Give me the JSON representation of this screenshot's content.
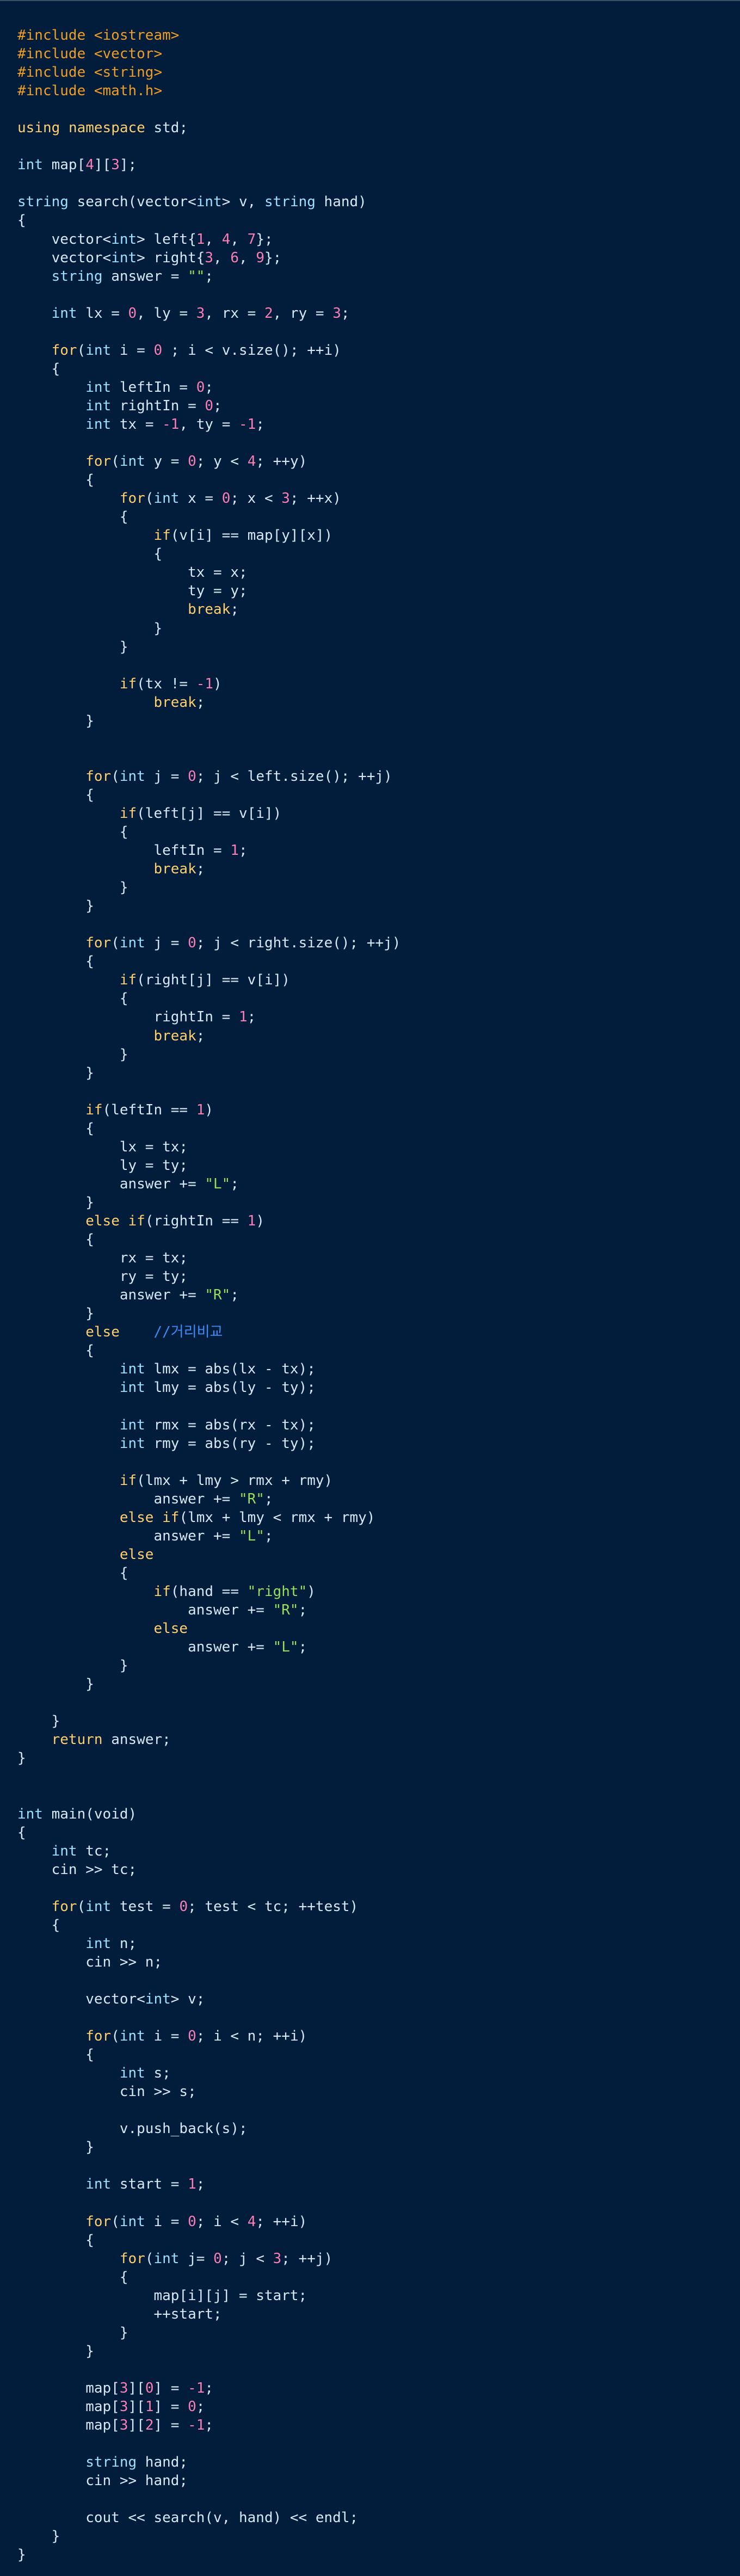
{
  "colors": {
    "background": "#011d3b",
    "plain": "#d7e8f6",
    "keyword": "#ffcf6e",
    "preprocessor": "#ef9d25",
    "type": "#9ee0ff",
    "number": "#f97fb4",
    "string": "#97df5c",
    "comment": "#3d8df5"
  },
  "code_lines": [
    [
      [
        "pp",
        "#include <iostream>"
      ]
    ],
    [
      [
        "pp",
        "#include <vector>"
      ]
    ],
    [
      [
        "pp",
        "#include <string>"
      ]
    ],
    [
      [
        "pp",
        "#include <math.h>"
      ]
    ],
    [],
    [
      [
        "k",
        "using"
      ],
      [
        "p",
        " "
      ],
      [
        "k",
        "namespace"
      ],
      [
        "p",
        " std;"
      ]
    ],
    [],
    [
      [
        "t",
        "int"
      ],
      [
        "p",
        " map["
      ],
      [
        "n",
        "4"
      ],
      [
        "p",
        "]["
      ],
      [
        "n",
        "3"
      ],
      [
        "p",
        "];"
      ]
    ],
    [],
    [
      [
        "t",
        "string"
      ],
      [
        "p",
        " search(vector<"
      ],
      [
        "t",
        "int"
      ],
      [
        "p",
        "> v, "
      ],
      [
        "t",
        "string"
      ],
      [
        "p",
        " hand)"
      ]
    ],
    [
      [
        "p",
        "{"
      ]
    ],
    [
      [
        "p",
        "    vector<"
      ],
      [
        "t",
        "int"
      ],
      [
        "p",
        "> left{"
      ],
      [
        "n",
        "1"
      ],
      [
        "p",
        ", "
      ],
      [
        "n",
        "4"
      ],
      [
        "p",
        ", "
      ],
      [
        "n",
        "7"
      ],
      [
        "p",
        "};"
      ]
    ],
    [
      [
        "p",
        "    vector<"
      ],
      [
        "t",
        "int"
      ],
      [
        "p",
        "> right{"
      ],
      [
        "n",
        "3"
      ],
      [
        "p",
        ", "
      ],
      [
        "n",
        "6"
      ],
      [
        "p",
        ", "
      ],
      [
        "n",
        "9"
      ],
      [
        "p",
        "};"
      ]
    ],
    [
      [
        "p",
        "    "
      ],
      [
        "t",
        "string"
      ],
      [
        "p",
        " answer = "
      ],
      [
        "s",
        "\"\""
      ],
      [
        "p",
        ";"
      ]
    ],
    [],
    [
      [
        "p",
        "    "
      ],
      [
        "t",
        "int"
      ],
      [
        "p",
        " lx = "
      ],
      [
        "n",
        "0"
      ],
      [
        "p",
        ", ly = "
      ],
      [
        "n",
        "3"
      ],
      [
        "p",
        ", rx = "
      ],
      [
        "n",
        "2"
      ],
      [
        "p",
        ", ry = "
      ],
      [
        "n",
        "3"
      ],
      [
        "p",
        ";"
      ]
    ],
    [],
    [
      [
        "p",
        "    "
      ],
      [
        "k",
        "for"
      ],
      [
        "p",
        "("
      ],
      [
        "t",
        "int"
      ],
      [
        "p",
        " i = "
      ],
      [
        "n",
        "0"
      ],
      [
        "p",
        " ; i < v.size(); ++i)"
      ]
    ],
    [
      [
        "p",
        "    {"
      ]
    ],
    [
      [
        "p",
        "        "
      ],
      [
        "t",
        "int"
      ],
      [
        "p",
        " leftIn = "
      ],
      [
        "n",
        "0"
      ],
      [
        "p",
        ";"
      ]
    ],
    [
      [
        "p",
        "        "
      ],
      [
        "t",
        "int"
      ],
      [
        "p",
        " rightIn = "
      ],
      [
        "n",
        "0"
      ],
      [
        "p",
        ";"
      ]
    ],
    [
      [
        "p",
        "        "
      ],
      [
        "t",
        "int"
      ],
      [
        "p",
        " tx = "
      ],
      [
        "n",
        "-1"
      ],
      [
        "p",
        ", ty = "
      ],
      [
        "n",
        "-1"
      ],
      [
        "p",
        ";"
      ]
    ],
    [],
    [
      [
        "p",
        "        "
      ],
      [
        "k",
        "for"
      ],
      [
        "p",
        "("
      ],
      [
        "t",
        "int"
      ],
      [
        "p",
        " y = "
      ],
      [
        "n",
        "0"
      ],
      [
        "p",
        "; y < "
      ],
      [
        "n",
        "4"
      ],
      [
        "p",
        "; ++y)"
      ]
    ],
    [
      [
        "p",
        "        {"
      ]
    ],
    [
      [
        "p",
        "            "
      ],
      [
        "k",
        "for"
      ],
      [
        "p",
        "("
      ],
      [
        "t",
        "int"
      ],
      [
        "p",
        " x = "
      ],
      [
        "n",
        "0"
      ],
      [
        "p",
        "; x < "
      ],
      [
        "n",
        "3"
      ],
      [
        "p",
        "; ++x)"
      ]
    ],
    [
      [
        "p",
        "            {"
      ]
    ],
    [
      [
        "p",
        "                "
      ],
      [
        "k",
        "if"
      ],
      [
        "p",
        "(v[i] == map[y][x])"
      ]
    ],
    [
      [
        "p",
        "                {"
      ]
    ],
    [
      [
        "p",
        "                    tx = x;"
      ]
    ],
    [
      [
        "p",
        "                    ty = y;"
      ]
    ],
    [
      [
        "p",
        "                    "
      ],
      [
        "k",
        "break"
      ],
      [
        "p",
        ";"
      ]
    ],
    [
      [
        "p",
        "                }"
      ]
    ],
    [
      [
        "p",
        "            }"
      ]
    ],
    [],
    [
      [
        "p",
        "            "
      ],
      [
        "k",
        "if"
      ],
      [
        "p",
        "(tx != "
      ],
      [
        "n",
        "-1"
      ],
      [
        "p",
        ")"
      ]
    ],
    [
      [
        "p",
        "                "
      ],
      [
        "k",
        "break"
      ],
      [
        "p",
        ";"
      ]
    ],
    [
      [
        "p",
        "        }"
      ]
    ],
    [],
    [],
    [
      [
        "p",
        "        "
      ],
      [
        "k",
        "for"
      ],
      [
        "p",
        "("
      ],
      [
        "t",
        "int"
      ],
      [
        "p",
        " j = "
      ],
      [
        "n",
        "0"
      ],
      [
        "p",
        "; j < left.size(); ++j)"
      ]
    ],
    [
      [
        "p",
        "        {"
      ]
    ],
    [
      [
        "p",
        "            "
      ],
      [
        "k",
        "if"
      ],
      [
        "p",
        "(left[j] == v[i])"
      ]
    ],
    [
      [
        "p",
        "            {"
      ]
    ],
    [
      [
        "p",
        "                leftIn = "
      ],
      [
        "n",
        "1"
      ],
      [
        "p",
        ";"
      ]
    ],
    [
      [
        "p",
        "                "
      ],
      [
        "k",
        "break"
      ],
      [
        "p",
        ";"
      ]
    ],
    [
      [
        "p",
        "            }"
      ]
    ],
    [
      [
        "p",
        "        }"
      ]
    ],
    [],
    [
      [
        "p",
        "        "
      ],
      [
        "k",
        "for"
      ],
      [
        "p",
        "("
      ],
      [
        "t",
        "int"
      ],
      [
        "p",
        " j = "
      ],
      [
        "n",
        "0"
      ],
      [
        "p",
        "; j < right.size(); ++j)"
      ]
    ],
    [
      [
        "p",
        "        {"
      ]
    ],
    [
      [
        "p",
        "            "
      ],
      [
        "k",
        "if"
      ],
      [
        "p",
        "(right[j] == v[i])"
      ]
    ],
    [
      [
        "p",
        "            {"
      ]
    ],
    [
      [
        "p",
        "                rightIn = "
      ],
      [
        "n",
        "1"
      ],
      [
        "p",
        ";"
      ]
    ],
    [
      [
        "p",
        "                "
      ],
      [
        "k",
        "break"
      ],
      [
        "p",
        ";"
      ]
    ],
    [
      [
        "p",
        "            }"
      ]
    ],
    [
      [
        "p",
        "        }"
      ]
    ],
    [],
    [
      [
        "p",
        "        "
      ],
      [
        "k",
        "if"
      ],
      [
        "p",
        "(leftIn == "
      ],
      [
        "n",
        "1"
      ],
      [
        "p",
        ")"
      ]
    ],
    [
      [
        "p",
        "        {"
      ]
    ],
    [
      [
        "p",
        "            lx = tx;"
      ]
    ],
    [
      [
        "p",
        "            ly = ty;"
      ]
    ],
    [
      [
        "p",
        "            answer += "
      ],
      [
        "s",
        "\"L\""
      ],
      [
        "p",
        ";"
      ]
    ],
    [
      [
        "p",
        "        }"
      ]
    ],
    [
      [
        "p",
        "        "
      ],
      [
        "k",
        "else"
      ],
      [
        "p",
        " "
      ],
      [
        "k",
        "if"
      ],
      [
        "p",
        "(rightIn == "
      ],
      [
        "n",
        "1"
      ],
      [
        "p",
        ")"
      ]
    ],
    [
      [
        "p",
        "        {"
      ]
    ],
    [
      [
        "p",
        "            rx = tx;"
      ]
    ],
    [
      [
        "p",
        "            ry = ty;"
      ]
    ],
    [
      [
        "p",
        "            answer += "
      ],
      [
        "s",
        "\"R\""
      ],
      [
        "p",
        ";"
      ]
    ],
    [
      [
        "p",
        "        }"
      ]
    ],
    [
      [
        "p",
        "        "
      ],
      [
        "k",
        "else"
      ],
      [
        "p",
        "    "
      ],
      [
        "c",
        "//거리비교"
      ]
    ],
    [
      [
        "p",
        "        {"
      ]
    ],
    [
      [
        "p",
        "            "
      ],
      [
        "t",
        "int"
      ],
      [
        "p",
        " lmx = abs(lx - tx);"
      ]
    ],
    [
      [
        "p",
        "            "
      ],
      [
        "t",
        "int"
      ],
      [
        "p",
        " lmy = abs(ly - ty);"
      ]
    ],
    [],
    [
      [
        "p",
        "            "
      ],
      [
        "t",
        "int"
      ],
      [
        "p",
        " rmx = abs(rx - tx);"
      ]
    ],
    [
      [
        "p",
        "            "
      ],
      [
        "t",
        "int"
      ],
      [
        "p",
        " rmy = abs(ry - ty);"
      ]
    ],
    [],
    [
      [
        "p",
        "            "
      ],
      [
        "k",
        "if"
      ],
      [
        "p",
        "(lmx + lmy > rmx + rmy)"
      ]
    ],
    [
      [
        "p",
        "                answer += "
      ],
      [
        "s",
        "\"R\""
      ],
      [
        "p",
        ";"
      ]
    ],
    [
      [
        "p",
        "            "
      ],
      [
        "k",
        "else"
      ],
      [
        "p",
        " "
      ],
      [
        "k",
        "if"
      ],
      [
        "p",
        "(lmx + lmy < rmx + rmy)"
      ]
    ],
    [
      [
        "p",
        "                answer += "
      ],
      [
        "s",
        "\"L\""
      ],
      [
        "p",
        ";"
      ]
    ],
    [
      [
        "p",
        "            "
      ],
      [
        "k",
        "else"
      ]
    ],
    [
      [
        "p",
        "            {"
      ]
    ],
    [
      [
        "p",
        "                "
      ],
      [
        "k",
        "if"
      ],
      [
        "p",
        "(hand == "
      ],
      [
        "s",
        "\"right\""
      ],
      [
        "p",
        ")"
      ]
    ],
    [
      [
        "p",
        "                    answer += "
      ],
      [
        "s",
        "\"R\""
      ],
      [
        "p",
        ";"
      ]
    ],
    [
      [
        "p",
        "                "
      ],
      [
        "k",
        "else"
      ]
    ],
    [
      [
        "p",
        "                    answer += "
      ],
      [
        "s",
        "\"L\""
      ],
      [
        "p",
        ";"
      ]
    ],
    [
      [
        "p",
        "            }"
      ]
    ],
    [
      [
        "p",
        "        }"
      ]
    ],
    [],
    [
      [
        "p",
        "    }"
      ]
    ],
    [
      [
        "p",
        "    "
      ],
      [
        "k",
        "return"
      ],
      [
        "p",
        " answer;"
      ]
    ],
    [
      [
        "p",
        "}"
      ]
    ],
    [],
    [],
    [
      [
        "t",
        "int"
      ],
      [
        "p",
        " main(void)"
      ]
    ],
    [
      [
        "p",
        "{"
      ]
    ],
    [
      [
        "p",
        "    "
      ],
      [
        "t",
        "int"
      ],
      [
        "p",
        " tc;"
      ]
    ],
    [
      [
        "p",
        "    cin >> tc;"
      ]
    ],
    [],
    [
      [
        "p",
        "    "
      ],
      [
        "k",
        "for"
      ],
      [
        "p",
        "("
      ],
      [
        "t",
        "int"
      ],
      [
        "p",
        " test = "
      ],
      [
        "n",
        "0"
      ],
      [
        "p",
        "; test < tc; ++test)"
      ]
    ],
    [
      [
        "p",
        "    {"
      ]
    ],
    [
      [
        "p",
        "        "
      ],
      [
        "t",
        "int"
      ],
      [
        "p",
        " n;"
      ]
    ],
    [
      [
        "p",
        "        cin >> n;"
      ]
    ],
    [],
    [
      [
        "p",
        "        vector<"
      ],
      [
        "t",
        "int"
      ],
      [
        "p",
        "> v;"
      ]
    ],
    [],
    [
      [
        "p",
        "        "
      ],
      [
        "k",
        "for"
      ],
      [
        "p",
        "("
      ],
      [
        "t",
        "int"
      ],
      [
        "p",
        " i = "
      ],
      [
        "n",
        "0"
      ],
      [
        "p",
        "; i < n; ++i)"
      ]
    ],
    [
      [
        "p",
        "        {"
      ]
    ],
    [
      [
        "p",
        "            "
      ],
      [
        "t",
        "int"
      ],
      [
        "p",
        " s;"
      ]
    ],
    [
      [
        "p",
        "            cin >> s;"
      ]
    ],
    [],
    [
      [
        "p",
        "            v.push_back(s);"
      ]
    ],
    [
      [
        "p",
        "        }"
      ]
    ],
    [],
    [
      [
        "p",
        "        "
      ],
      [
        "t",
        "int"
      ],
      [
        "p",
        " start = "
      ],
      [
        "n",
        "1"
      ],
      [
        "p",
        ";"
      ]
    ],
    [],
    [
      [
        "p",
        "        "
      ],
      [
        "k",
        "for"
      ],
      [
        "p",
        "("
      ],
      [
        "t",
        "int"
      ],
      [
        "p",
        " i = "
      ],
      [
        "n",
        "0"
      ],
      [
        "p",
        "; i < "
      ],
      [
        "n",
        "4"
      ],
      [
        "p",
        "; ++i)"
      ]
    ],
    [
      [
        "p",
        "        {"
      ]
    ],
    [
      [
        "p",
        "            "
      ],
      [
        "k",
        "for"
      ],
      [
        "p",
        "("
      ],
      [
        "t",
        "int"
      ],
      [
        "p",
        " j= "
      ],
      [
        "n",
        "0"
      ],
      [
        "p",
        "; j < "
      ],
      [
        "n",
        "3"
      ],
      [
        "p",
        "; ++j)"
      ]
    ],
    [
      [
        "p",
        "            {"
      ]
    ],
    [
      [
        "p",
        "                map[i][j] = start;"
      ]
    ],
    [
      [
        "p",
        "                ++start;"
      ]
    ],
    [
      [
        "p",
        "            }"
      ]
    ],
    [
      [
        "p",
        "        }"
      ]
    ],
    [],
    [
      [
        "p",
        "        map["
      ],
      [
        "n",
        "3"
      ],
      [
        "p",
        "]["
      ],
      [
        "n",
        "0"
      ],
      [
        "p",
        "] = "
      ],
      [
        "n",
        "-1"
      ],
      [
        "p",
        ";"
      ]
    ],
    [
      [
        "p",
        "        map["
      ],
      [
        "n",
        "3"
      ],
      [
        "p",
        "]["
      ],
      [
        "n",
        "1"
      ],
      [
        "p",
        "] = "
      ],
      [
        "n",
        "0"
      ],
      [
        "p",
        ";"
      ]
    ],
    [
      [
        "p",
        "        map["
      ],
      [
        "n",
        "3"
      ],
      [
        "p",
        "]["
      ],
      [
        "n",
        "2"
      ],
      [
        "p",
        "] = "
      ],
      [
        "n",
        "-1"
      ],
      [
        "p",
        ";"
      ]
    ],
    [],
    [
      [
        "p",
        "        "
      ],
      [
        "t",
        "string"
      ],
      [
        "p",
        " hand;"
      ]
    ],
    [
      [
        "p",
        "        cin >> hand;"
      ]
    ],
    [],
    [
      [
        "p",
        "        cout << search(v, hand) << endl;"
      ]
    ],
    [
      [
        "p",
        "    }"
      ]
    ],
    [
      [
        "p",
        "}"
      ]
    ]
  ]
}
